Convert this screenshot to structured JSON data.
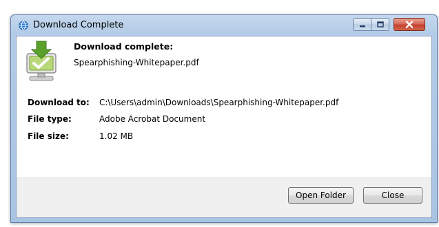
{
  "window": {
    "title": "Download Complete"
  },
  "content": {
    "heading": "Download complete:",
    "filename": "Spearphishing-Whitepaper.pdf",
    "details": [
      {
        "label": "Download to:",
        "value": "C:\\Users\\admin\\Downloads\\Spearphishing-Whitepaper.pdf"
      },
      {
        "label": "File type:",
        "value": "Adobe Acrobat Document"
      },
      {
        "label": "File size:",
        "value": "1.02 MB"
      }
    ]
  },
  "buttons": {
    "open_folder": "Open Folder",
    "close": "Close"
  },
  "icons": {
    "title": "globe-icon",
    "app": "download-complete-icon",
    "minimize": "minimize-icon",
    "maximize": "maximize-icon",
    "close": "close-icon"
  },
  "colors": {
    "titlebar": "#b3cbe7",
    "close_button": "#c2412f",
    "download_arrow": "#5aa12c"
  }
}
